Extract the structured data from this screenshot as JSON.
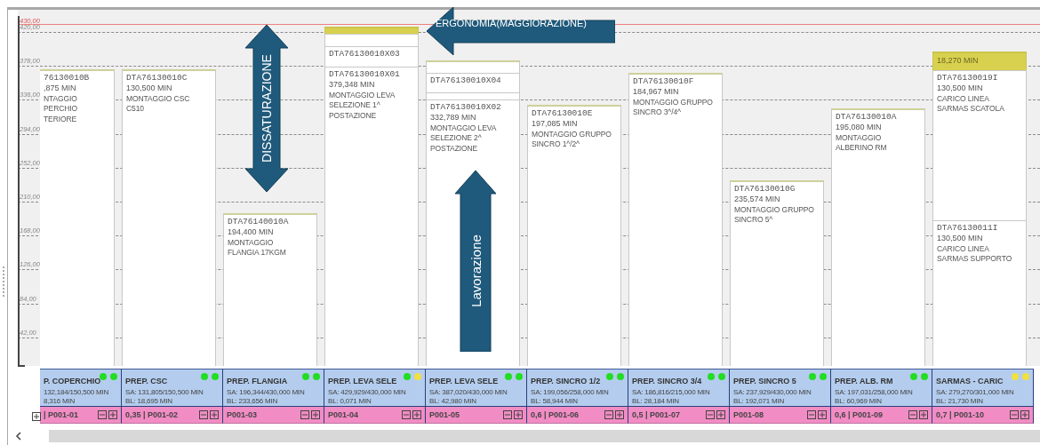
{
  "y_axis": {
    "limit": "430,00",
    "labels": [
      "420,00",
      "378,00",
      "336,00",
      "294,00",
      "252,00",
      "210,00",
      "168,00",
      "126,00",
      "84,00",
      "42,00"
    ]
  },
  "columns": [
    {
      "blocks": [
        {
          "kind": "task",
          "code": "76130010B",
          "minutes": ",875 MIN",
          "description": "NTAGGIO\nPERCHIO\nTERIORE"
        }
      ],
      "header": {
        "title": "P. COPERCHIO",
        "dots": [
          {
            "color": "#22dd22"
          },
          {
            "color": "#22dd22"
          }
        ],
        "sa": "132,184/150,500 MIN",
        "bl": "8,316 MIN"
      },
      "footer": "| P001-01"
    },
    {
      "blocks": [
        {
          "kind": "task",
          "code": "DTA76130010C",
          "minutes": "130,500 MIN",
          "description": "MONTAGGIO CSC\nC510"
        }
      ],
      "header": {
        "title": "PREP. CSC",
        "dots": [
          {
            "color": "#22dd22"
          },
          {
            "color": "#22dd22"
          }
        ],
        "sa": "SA: 131,805/150,500 MIN",
        "bl": "BL: 18,695 MIN"
      },
      "footer": "0,35 | P001-02"
    },
    {
      "blocks": [
        {
          "kind": "task",
          "code": "DTA76140010A",
          "minutes": "194,400 MIN",
          "description": "MONTAGGIO\nFLANGIA 17KGM"
        }
      ],
      "header": {
        "title": "PREP. FLANGIA",
        "dots": [
          {
            "color": "#22dd22"
          },
          {
            "color": "#22dd22"
          }
        ],
        "sa": "SA: 196,344/430,000 MIN",
        "bl": "BL: 233,656 MIN"
      },
      "footer": "P001-03"
    },
    {
      "blocks": [
        {
          "kind": "ergonomics"
        },
        {
          "kind": "spacer"
        },
        {
          "kind": "task",
          "code": "DTA76130010X03"
        },
        {
          "kind": "task",
          "code": "DTA76130010X01",
          "minutes": "379,348 MIN",
          "description": "MONTAGGIO LEVA\nSELEZIONE 1^\nPOSTAZIONE"
        }
      ],
      "header": {
        "title": "PREP. LEVA SELE",
        "dots": [
          {
            "color": "#22dd22"
          },
          {
            "color": "#f0e040"
          }
        ],
        "sa": "SA: 429,929/430,000 MIN",
        "bl": "BL: 0,071 MIN"
      },
      "footer": "P001-04"
    },
    {
      "blocks": [
        {
          "kind": "spacer"
        },
        {
          "kind": "task",
          "code": "DTA76130010X04"
        },
        {
          "kind": "spacer"
        },
        {
          "kind": "task",
          "code": "DTA76130010X02",
          "minutes": "332,789 MIN",
          "description": "MONTAGGIO LEVA\nSELEZIONE 2^\nPOSTAZIONE"
        }
      ],
      "header": {
        "title": "PREP. LEVA SELE",
        "dots": [
          {
            "color": "#22dd22"
          },
          {
            "color": "#22dd22"
          }
        ],
        "sa": "SA: 387,020/430,000 MIN",
        "bl": "BL: 42,980 MIN"
      },
      "footer": "P001-05"
    },
    {
      "blocks": [
        {
          "kind": "task",
          "code": "DTA76130010E",
          "minutes": "197,085 MIN",
          "description": "MONTAGGIO GRUPPO\nSINCRO 1^/2^"
        }
      ],
      "header": {
        "title": "PREP. SINCRO 1/2",
        "dots": [
          {
            "color": "#22dd22"
          },
          {
            "color": "#22dd22"
          }
        ],
        "sa": "SA: 199,056/258,000 MIN",
        "bl": "BL: 58,944 MIN"
      },
      "footer": "0,6 | P001-06"
    },
    {
      "blocks": [
        {
          "kind": "task",
          "code": "DTA76130010F",
          "minutes": "184,967 MIN",
          "description": "MONTAGGIO GRUPPO\nSINCRO 3^/4^"
        }
      ],
      "header": {
        "title": "PREP. SINCRO 3/4",
        "dots": [
          {
            "color": "#22dd22"
          },
          {
            "color": "#22dd22"
          }
        ],
        "sa": "SA: 186,816/215,000 MIN",
        "bl": "BL: 28,184 MIN"
      },
      "footer": "0,5 | P001-07"
    },
    {
      "blocks": [
        {
          "kind": "task",
          "code": "DTA76130010G",
          "minutes": "235,574 MIN",
          "description": "MONTAGGIO GRUPPO\nSINCRO 5^"
        }
      ],
      "header": {
        "title": "PREP. SINCRO 5",
        "dots": [
          {
            "color": "#22dd22"
          },
          {
            "color": "#22dd22"
          }
        ],
        "sa": "SA: 237,929/430,000 MIN",
        "bl": "BL: 192,071 MIN"
      },
      "footer": "P001-08"
    },
    {
      "blocks": [
        {
          "kind": "task",
          "code": "DTA76130010A",
          "minutes": "195,080 MIN",
          "description": "MONTAGGIO\nALBERINO RM"
        }
      ],
      "header": {
        "title": "PREP. ALB. RM",
        "dots": [
          {
            "color": "#22dd22"
          },
          {
            "color": "#22dd22"
          }
        ],
        "sa": "SA: 197,031/258,000 MIN",
        "bl": "BL: 60,969 MIN"
      },
      "footer": "0,6 | P001-09"
    },
    {
      "blocks": [
        {
          "kind": "ergonomics",
          "minutes": "18,270 MIN"
        },
        {
          "kind": "task",
          "code": "DTA76130019I",
          "minutes": "130,500 MIN",
          "description": "CARICO LINEA\nSARMAS SCATOLA"
        },
        {
          "kind": "task",
          "code": "DTA76130011I",
          "minutes": "130,500 MIN",
          "description": "CARICO LINEA\nSARMAS SUPPORTO"
        }
      ],
      "header": {
        "title": "SARMAS - CARIC",
        "dots": [
          {
            "color": "#f0e040"
          },
          {
            "color": "#f0e040"
          }
        ],
        "sa": "SA: 279,270/301,000 MIN",
        "bl": "BL: 21,730 MIN"
      },
      "footer": "0,7 | P001-10"
    }
  ],
  "annotations": [
    {
      "kind": "double_arrow",
      "text": "DISSATURAZIONE"
    },
    {
      "kind": "left_arrow",
      "text": "ERGONOMIA(MAGGIORAZIONE)"
    },
    {
      "kind": "up_arrow",
      "text": "Lavorazione"
    }
  ]
}
